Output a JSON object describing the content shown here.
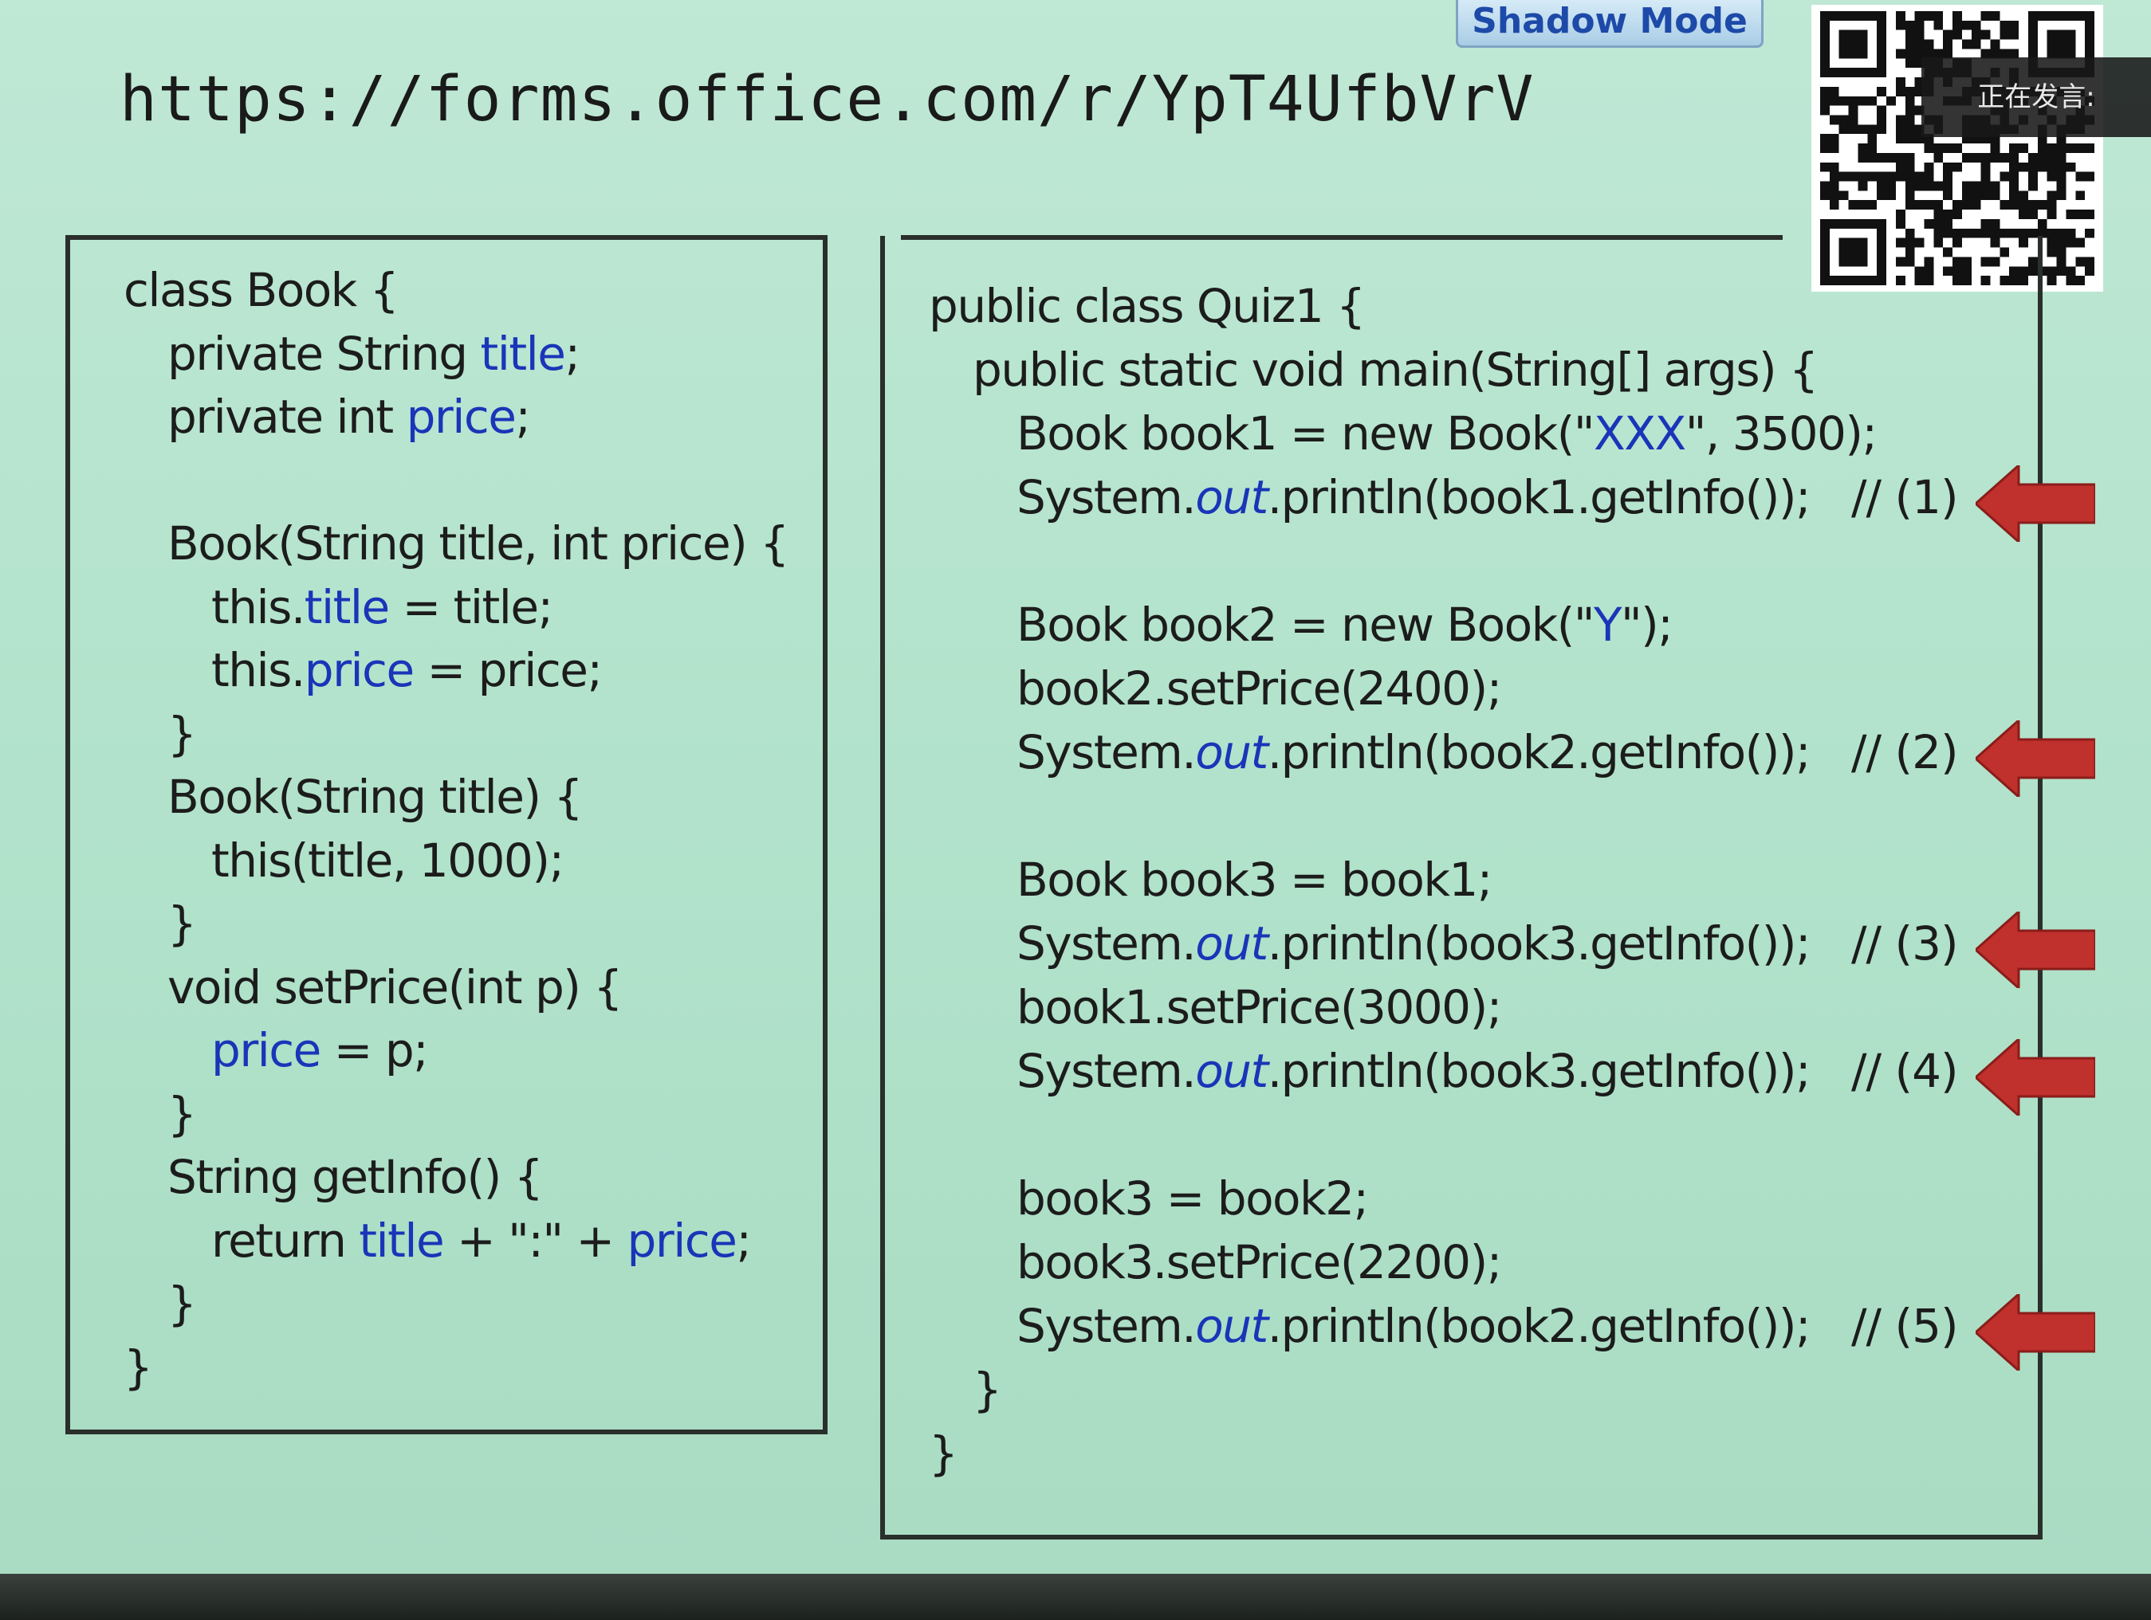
{
  "header": {
    "url": "https://forms.office.com/r/YpT4UfbVrV",
    "shadow_mode": "Shadow Mode",
    "speaking_indicator": "正在发言:"
  },
  "left_code": [
    {
      "indent": 0,
      "parts": [
        {
          "t": "class Book {",
          "c": ""
        }
      ]
    },
    {
      "indent": 1,
      "parts": [
        {
          "t": "private String ",
          "c": ""
        },
        {
          "t": "title",
          "c": "blue"
        },
        {
          "t": ";",
          "c": ""
        }
      ]
    },
    {
      "indent": 1,
      "parts": [
        {
          "t": "private int ",
          "c": ""
        },
        {
          "t": "price",
          "c": "blue"
        },
        {
          "t": ";",
          "c": ""
        }
      ]
    },
    {
      "indent": 1,
      "parts": [
        {
          "t": "",
          "c": ""
        }
      ]
    },
    {
      "indent": 1,
      "parts": [
        {
          "t": "Book(String title, int price) {",
          "c": ""
        }
      ]
    },
    {
      "indent": 2,
      "parts": [
        {
          "t": "this.",
          "c": ""
        },
        {
          "t": "title",
          "c": "blue"
        },
        {
          "t": " = title;",
          "c": ""
        }
      ]
    },
    {
      "indent": 2,
      "parts": [
        {
          "t": "this.",
          "c": ""
        },
        {
          "t": "price",
          "c": "blue"
        },
        {
          "t": " = price;",
          "c": ""
        }
      ]
    },
    {
      "indent": 1,
      "parts": [
        {
          "t": "}",
          "c": ""
        }
      ]
    },
    {
      "indent": 1,
      "parts": [
        {
          "t": "Book(String title) {",
          "c": ""
        }
      ]
    },
    {
      "indent": 2,
      "parts": [
        {
          "t": "this(title, 1000);",
          "c": ""
        }
      ]
    },
    {
      "indent": 1,
      "parts": [
        {
          "t": "}",
          "c": ""
        }
      ]
    },
    {
      "indent": 1,
      "parts": [
        {
          "t": "void setPrice(int p) {",
          "c": ""
        }
      ]
    },
    {
      "indent": 2,
      "parts": [
        {
          "t": "price",
          "c": "blue"
        },
        {
          "t": " = p;",
          "c": ""
        }
      ]
    },
    {
      "indent": 1,
      "parts": [
        {
          "t": "}",
          "c": ""
        }
      ]
    },
    {
      "indent": 1,
      "parts": [
        {
          "t": "String getInfo() {",
          "c": ""
        }
      ]
    },
    {
      "indent": 2,
      "parts": [
        {
          "t": "return ",
          "c": ""
        },
        {
          "t": "title",
          "c": "blue"
        },
        {
          "t": " + \":\" + ",
          "c": ""
        },
        {
          "t": "price",
          "c": "blue"
        },
        {
          "t": ";",
          "c": ""
        }
      ]
    },
    {
      "indent": 1,
      "parts": [
        {
          "t": "}",
          "c": ""
        }
      ]
    },
    {
      "indent": 0,
      "parts": [
        {
          "t": "}",
          "c": ""
        }
      ]
    }
  ],
  "right_code": [
    {
      "indent": 0,
      "parts": [
        {
          "t": "public class Quiz1 {",
          "c": ""
        }
      ]
    },
    {
      "indent": 1,
      "parts": [
        {
          "t": "public static void main(String[] args) {",
          "c": ""
        }
      ]
    },
    {
      "indent": 2,
      "parts": [
        {
          "t": "Book book1 = new Book(\"",
          "c": ""
        },
        {
          "t": "XXX",
          "c": "blue"
        },
        {
          "t": "\", 3500);",
          "c": ""
        }
      ]
    },
    {
      "indent": 2,
      "parts": [
        {
          "t": "System.",
          "c": ""
        },
        {
          "t": "out",
          "c": "out"
        },
        {
          "t": ".println(book1.getInfo());",
          "c": ""
        }
      ],
      "comment": "// (1)",
      "arrow": true
    },
    {
      "indent": 2,
      "parts": [
        {
          "t": "",
          "c": ""
        }
      ]
    },
    {
      "indent": 2,
      "parts": [
        {
          "t": "Book book2 = new Book(\"",
          "c": ""
        },
        {
          "t": "Y",
          "c": "blue"
        },
        {
          "t": "\");",
          "c": ""
        }
      ]
    },
    {
      "indent": 2,
      "parts": [
        {
          "t": "book2.setPrice(2400);",
          "c": ""
        }
      ]
    },
    {
      "indent": 2,
      "parts": [
        {
          "t": "System.",
          "c": ""
        },
        {
          "t": "out",
          "c": "out"
        },
        {
          "t": ".println(book2.getInfo());",
          "c": ""
        }
      ],
      "comment": "// (2)",
      "arrow": true
    },
    {
      "indent": 2,
      "parts": [
        {
          "t": "",
          "c": ""
        }
      ]
    },
    {
      "indent": 2,
      "parts": [
        {
          "t": "Book book3 = book1;",
          "c": ""
        }
      ]
    },
    {
      "indent": 2,
      "parts": [
        {
          "t": "System.",
          "c": ""
        },
        {
          "t": "out",
          "c": "out"
        },
        {
          "t": ".println(book3.getInfo());",
          "c": ""
        }
      ],
      "comment": "// (3)",
      "arrow": true
    },
    {
      "indent": 2,
      "parts": [
        {
          "t": "book1.setPrice(3000);",
          "c": ""
        }
      ]
    },
    {
      "indent": 2,
      "parts": [
        {
          "t": "System.",
          "c": ""
        },
        {
          "t": "out",
          "c": "out"
        },
        {
          "t": ".println(book3.getInfo());",
          "c": ""
        }
      ],
      "comment": "// (4)",
      "arrow": true
    },
    {
      "indent": 2,
      "parts": [
        {
          "t": "",
          "c": ""
        }
      ]
    },
    {
      "indent": 2,
      "parts": [
        {
          "t": "book3 = book2;",
          "c": ""
        }
      ]
    },
    {
      "indent": 2,
      "parts": [
        {
          "t": "book3.setPrice(2200);",
          "c": ""
        }
      ]
    },
    {
      "indent": 2,
      "parts": [
        {
          "t": "System.",
          "c": ""
        },
        {
          "t": "out",
          "c": "out"
        },
        {
          "t": ".println(book2.getInfo());",
          "c": ""
        }
      ],
      "comment": "// (5)",
      "arrow": true
    },
    {
      "indent": 1,
      "parts": [
        {
          "t": "}",
          "c": ""
        }
      ]
    },
    {
      "indent": 0,
      "parts": [
        {
          "t": "}",
          "c": ""
        }
      ]
    }
  ],
  "colors": {
    "keyword_blue": "#1a35b8",
    "arrow_red": "#c0302c",
    "slide_bg": "#b3e3cc"
  },
  "icons": {
    "qr": "qr-code-icon",
    "arrow": "left-arrow-icon"
  }
}
